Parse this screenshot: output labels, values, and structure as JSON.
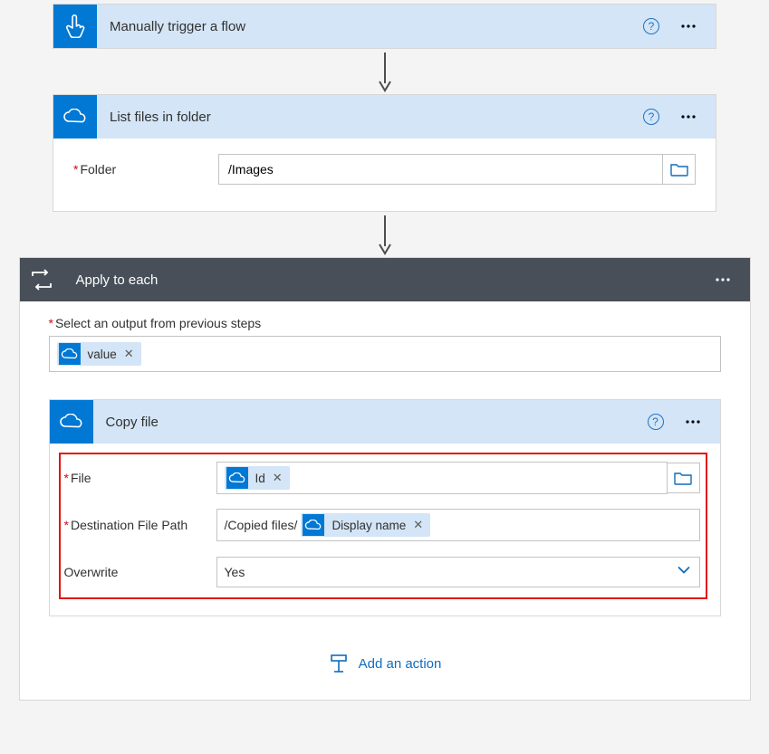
{
  "trigger": {
    "title": "Manually trigger a flow"
  },
  "listFiles": {
    "title": "List files in folder",
    "fields": {
      "folder_label": "Folder",
      "folder_value": "/Images"
    }
  },
  "applyToEach": {
    "title": "Apply to each",
    "select_label": "Select an output from previous steps",
    "token_value": "value"
  },
  "copyFile": {
    "title": "Copy file",
    "file_label": "File",
    "file_token": "Id",
    "dest_label": "Destination File Path",
    "dest_prefix": "/Copied files/",
    "dest_token": "Display name",
    "overwrite_label": "Overwrite",
    "overwrite_value": "Yes"
  },
  "add_action": "Add an action"
}
